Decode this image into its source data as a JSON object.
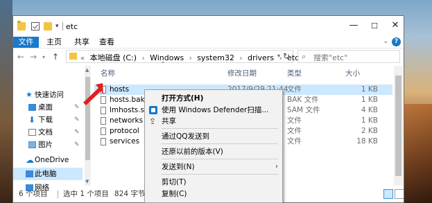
{
  "window": {
    "title": "etc",
    "controls": {
      "minimize": "—",
      "maximize": "☐",
      "close": "✕"
    }
  },
  "ribbon": {
    "tabs": [
      "文件",
      "主页",
      "共享",
      "查看"
    ],
    "help": "?"
  },
  "address": {
    "crumbs": [
      "«",
      "本地磁盘 (C:)",
      "›",
      "Windows",
      "›",
      "system32",
      "›",
      "drivers",
      "›",
      "etc"
    ],
    "search_placeholder": "搜索\"etc\""
  },
  "navpane": {
    "items": [
      {
        "label": "快速访问",
        "icon": "star-icon",
        "pinned": false
      },
      {
        "label": "桌面",
        "icon": "desktop-icon",
        "pinned": true
      },
      {
        "label": "下载",
        "icon": "download-icon",
        "pinned": true
      },
      {
        "label": "文档",
        "icon": "documents-icon",
        "pinned": true
      },
      {
        "label": "图片",
        "icon": "pictures-icon",
        "pinned": true
      },
      {
        "label": "OneDrive",
        "icon": "onedrive-icon",
        "pinned": false
      },
      {
        "label": "此电脑",
        "icon": "this-pc-icon",
        "pinned": false
      },
      {
        "label": "网络",
        "icon": "network-icon",
        "pinned": false
      }
    ]
  },
  "filelist": {
    "columns": {
      "name": "名称",
      "date": "修改日期",
      "type": "类型",
      "size": "大小"
    },
    "rows": [
      {
        "name": "hosts",
        "date": "2017/9/29 21:44",
        "type": "文件",
        "size": "1 KB",
        "selected": true
      },
      {
        "name": "hosts.bak",
        "date": "",
        "type": "BAK 文件",
        "size": "1 KB",
        "selected": false
      },
      {
        "name": "lmhosts.sam",
        "date": "",
        "type": "SAM 文件",
        "size": "4 KB",
        "selected": false
      },
      {
        "name": "networks",
        "date": "",
        "type": "文件",
        "size": "1 KB",
        "selected": false
      },
      {
        "name": "protocol",
        "date": "",
        "type": "文件",
        "size": "2 KB",
        "selected": false
      },
      {
        "name": "services",
        "date": "",
        "type": "文件",
        "size": "18 KB",
        "selected": false
      }
    ]
  },
  "statusbar": {
    "count": "6 个项目",
    "selected": "选中 1 个项目",
    "size": "824 字节"
  },
  "context_menu": {
    "items": [
      {
        "label": "打开方式(H)",
        "bold": true,
        "icon": ""
      },
      {
        "label": "使用 Windows Defender扫描...",
        "bold": false,
        "icon": "defender-shield-icon"
      },
      {
        "label": "共享",
        "bold": false,
        "icon": "share-icon"
      },
      {
        "label": "通过QQ发送到",
        "bold": false,
        "icon": ""
      },
      {
        "label": "还原以前的版本(V)",
        "bold": false,
        "icon": ""
      },
      {
        "label": "发送到(N)",
        "bold": false,
        "icon": "",
        "submenu": "›"
      },
      {
        "label": "剪切(T)",
        "bold": false,
        "icon": ""
      },
      {
        "label": "复制(C)",
        "bold": false,
        "icon": ""
      }
    ]
  },
  "colors": {
    "accent": "#1979ca",
    "selection": "#cce8ff",
    "annotation_arrow": "#e02020"
  }
}
